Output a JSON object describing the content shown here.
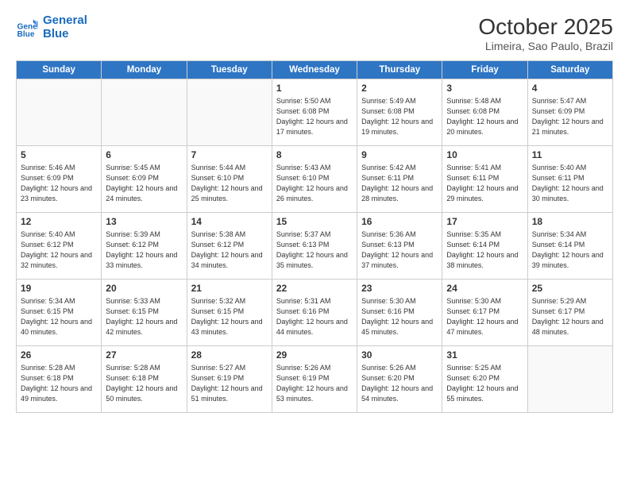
{
  "logo": {
    "line1": "General",
    "line2": "Blue"
  },
  "title": "October 2025",
  "subtitle": "Limeira, Sao Paulo, Brazil",
  "days_header": [
    "Sunday",
    "Monday",
    "Tuesday",
    "Wednesday",
    "Thursday",
    "Friday",
    "Saturday"
  ],
  "weeks": [
    [
      {
        "day": "",
        "info": ""
      },
      {
        "day": "",
        "info": ""
      },
      {
        "day": "",
        "info": ""
      },
      {
        "day": "1",
        "info": "Sunrise: 5:50 AM\nSunset: 6:08 PM\nDaylight: 12 hours and 17 minutes."
      },
      {
        "day": "2",
        "info": "Sunrise: 5:49 AM\nSunset: 6:08 PM\nDaylight: 12 hours and 19 minutes."
      },
      {
        "day": "3",
        "info": "Sunrise: 5:48 AM\nSunset: 6:08 PM\nDaylight: 12 hours and 20 minutes."
      },
      {
        "day": "4",
        "info": "Sunrise: 5:47 AM\nSunset: 6:09 PM\nDaylight: 12 hours and 21 minutes."
      }
    ],
    [
      {
        "day": "5",
        "info": "Sunrise: 5:46 AM\nSunset: 6:09 PM\nDaylight: 12 hours and 23 minutes."
      },
      {
        "day": "6",
        "info": "Sunrise: 5:45 AM\nSunset: 6:09 PM\nDaylight: 12 hours and 24 minutes."
      },
      {
        "day": "7",
        "info": "Sunrise: 5:44 AM\nSunset: 6:10 PM\nDaylight: 12 hours and 25 minutes."
      },
      {
        "day": "8",
        "info": "Sunrise: 5:43 AM\nSunset: 6:10 PM\nDaylight: 12 hours and 26 minutes."
      },
      {
        "day": "9",
        "info": "Sunrise: 5:42 AM\nSunset: 6:11 PM\nDaylight: 12 hours and 28 minutes."
      },
      {
        "day": "10",
        "info": "Sunrise: 5:41 AM\nSunset: 6:11 PM\nDaylight: 12 hours and 29 minutes."
      },
      {
        "day": "11",
        "info": "Sunrise: 5:40 AM\nSunset: 6:11 PM\nDaylight: 12 hours and 30 minutes."
      }
    ],
    [
      {
        "day": "12",
        "info": "Sunrise: 5:40 AM\nSunset: 6:12 PM\nDaylight: 12 hours and 32 minutes."
      },
      {
        "day": "13",
        "info": "Sunrise: 5:39 AM\nSunset: 6:12 PM\nDaylight: 12 hours and 33 minutes."
      },
      {
        "day": "14",
        "info": "Sunrise: 5:38 AM\nSunset: 6:12 PM\nDaylight: 12 hours and 34 minutes."
      },
      {
        "day": "15",
        "info": "Sunrise: 5:37 AM\nSunset: 6:13 PM\nDaylight: 12 hours and 35 minutes."
      },
      {
        "day": "16",
        "info": "Sunrise: 5:36 AM\nSunset: 6:13 PM\nDaylight: 12 hours and 37 minutes."
      },
      {
        "day": "17",
        "info": "Sunrise: 5:35 AM\nSunset: 6:14 PM\nDaylight: 12 hours and 38 minutes."
      },
      {
        "day": "18",
        "info": "Sunrise: 5:34 AM\nSunset: 6:14 PM\nDaylight: 12 hours and 39 minutes."
      }
    ],
    [
      {
        "day": "19",
        "info": "Sunrise: 5:34 AM\nSunset: 6:15 PM\nDaylight: 12 hours and 40 minutes."
      },
      {
        "day": "20",
        "info": "Sunrise: 5:33 AM\nSunset: 6:15 PM\nDaylight: 12 hours and 42 minutes."
      },
      {
        "day": "21",
        "info": "Sunrise: 5:32 AM\nSunset: 6:15 PM\nDaylight: 12 hours and 43 minutes."
      },
      {
        "day": "22",
        "info": "Sunrise: 5:31 AM\nSunset: 6:16 PM\nDaylight: 12 hours and 44 minutes."
      },
      {
        "day": "23",
        "info": "Sunrise: 5:30 AM\nSunset: 6:16 PM\nDaylight: 12 hours and 45 minutes."
      },
      {
        "day": "24",
        "info": "Sunrise: 5:30 AM\nSunset: 6:17 PM\nDaylight: 12 hours and 47 minutes."
      },
      {
        "day": "25",
        "info": "Sunrise: 5:29 AM\nSunset: 6:17 PM\nDaylight: 12 hours and 48 minutes."
      }
    ],
    [
      {
        "day": "26",
        "info": "Sunrise: 5:28 AM\nSunset: 6:18 PM\nDaylight: 12 hours and 49 minutes."
      },
      {
        "day": "27",
        "info": "Sunrise: 5:28 AM\nSunset: 6:18 PM\nDaylight: 12 hours and 50 minutes."
      },
      {
        "day": "28",
        "info": "Sunrise: 5:27 AM\nSunset: 6:19 PM\nDaylight: 12 hours and 51 minutes."
      },
      {
        "day": "29",
        "info": "Sunrise: 5:26 AM\nSunset: 6:19 PM\nDaylight: 12 hours and 53 minutes."
      },
      {
        "day": "30",
        "info": "Sunrise: 5:26 AM\nSunset: 6:20 PM\nDaylight: 12 hours and 54 minutes."
      },
      {
        "day": "31",
        "info": "Sunrise: 5:25 AM\nSunset: 6:20 PM\nDaylight: 12 hours and 55 minutes."
      },
      {
        "day": "",
        "info": ""
      }
    ]
  ]
}
